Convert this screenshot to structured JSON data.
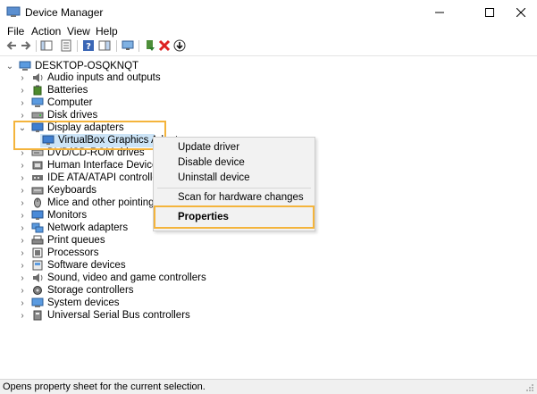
{
  "window": {
    "title": "Device Manager"
  },
  "menubar": {
    "items": [
      "File",
      "Action",
      "View",
      "Help"
    ]
  },
  "toolbar": {
    "buttons": [
      "back-icon",
      "forward-icon",
      "console-tree-icon",
      "properties-icon",
      "help-icon",
      "action-pane-icon",
      "scan-hardware-icon",
      "add-driver-icon",
      "uninstall-icon",
      "update-driver-icon"
    ]
  },
  "tree": {
    "root": "DESKTOP-OSQKNQT",
    "categories": [
      "Audio inputs and outputs",
      "Batteries",
      "Computer",
      "Disk drives",
      "Display adapters",
      "DVD/CD-ROM drives",
      "Human Interface Devices",
      "IDE ATA/ATAPI controllers",
      "Keyboards",
      "Mice and other pointing devic",
      "Monitors",
      "Network adapters",
      "Print queues",
      "Processors",
      "Software devices",
      "Sound, video and game controllers",
      "Storage controllers",
      "System devices",
      "Universal Serial Bus controllers"
    ],
    "display_child": "VirtualBox Graphics Adapt"
  },
  "context_menu": {
    "update_driver": "Update driver",
    "disable_device": "Disable device",
    "uninstall_device": "Uninstall device",
    "scan": "Scan for hardware changes",
    "properties": "Properties"
  },
  "statusbar": {
    "text": "Opens property sheet for the current selection."
  },
  "colors": {
    "highlight_box": "#f4b43c",
    "selection": "#cce4f7",
    "menu_bg": "#f2f2f2"
  }
}
